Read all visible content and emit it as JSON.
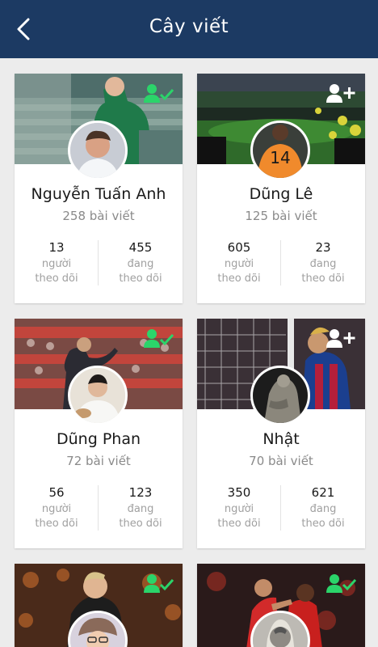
{
  "header": {
    "title": "Cây viết",
    "back_icon": "chevron-left-icon"
  },
  "colors": {
    "header_bg": "#1c3a63",
    "follow_green": "#2bd46a",
    "follow_white": "#ffffff"
  },
  "writers": [
    {
      "name": "Nguyễn Tuấn Anh",
      "posts": "258 bài viết",
      "followers": "13",
      "followers_label_1": "người",
      "followers_label_2": "theo dõi",
      "following": "455",
      "following_label_1": "đang",
      "following_label_2": "theo dõi",
      "follow_icon": "user-check-icon"
    },
    {
      "name": "Dũng Lê",
      "posts": "125 bài viết",
      "followers": "605",
      "followers_label_1": "người",
      "followers_label_2": "theo dõi",
      "following": "23",
      "following_label_1": "đang",
      "following_label_2": "theo dõi",
      "follow_icon": "user-add-icon"
    },
    {
      "name": "Dũng Phan",
      "posts": "72 bài viết",
      "followers": "56",
      "followers_label_1": "người",
      "followers_label_2": "theo dõi",
      "following": "123",
      "following_label_1": "đang",
      "following_label_2": "theo dõi",
      "follow_icon": "user-check-icon"
    },
    {
      "name": "Nhật",
      "posts": "70 bài viết",
      "followers": "350",
      "followers_label_1": "người",
      "followers_label_2": "theo dõi",
      "following": "621",
      "following_label_1": "đang",
      "following_label_2": "theo dõi",
      "follow_icon": "user-add-icon"
    },
    {
      "name": "",
      "posts": "",
      "followers": "",
      "following": "",
      "follow_icon": "user-check-icon"
    },
    {
      "name": "",
      "posts": "",
      "followers": "",
      "following": "",
      "follow_icon": "user-check-icon"
    }
  ]
}
